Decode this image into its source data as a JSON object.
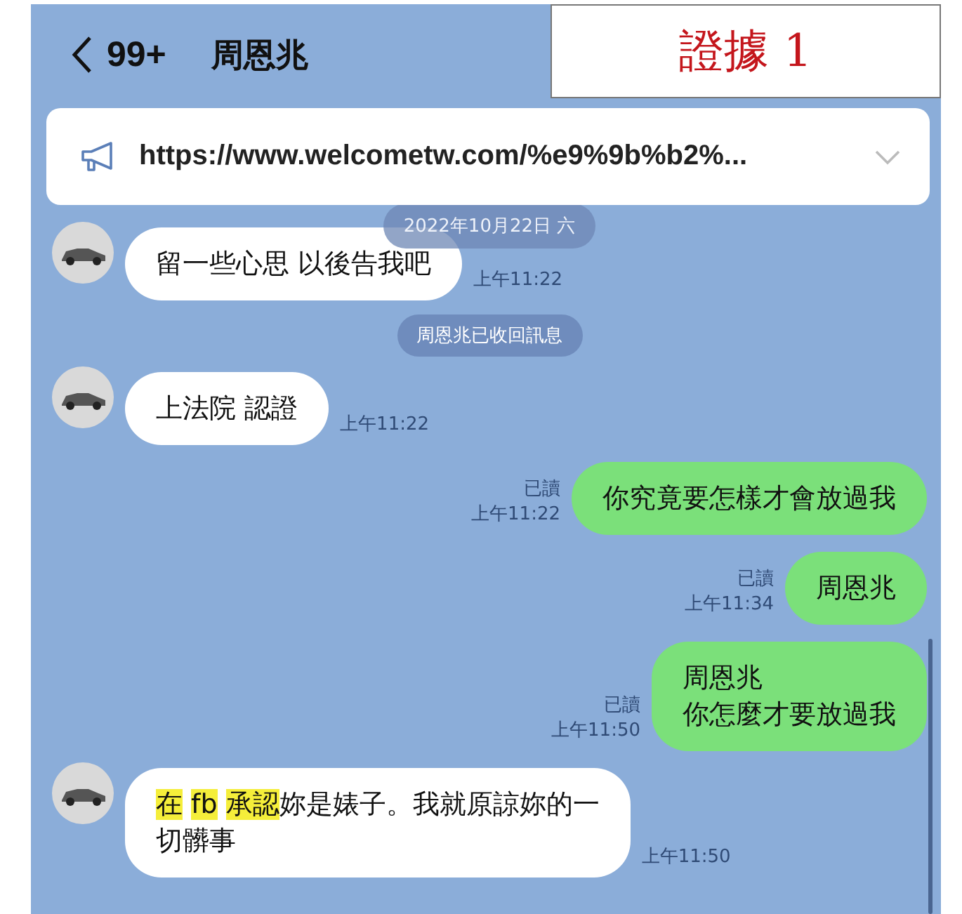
{
  "header": {
    "back_count": "99+",
    "contact": "周恩兆"
  },
  "evidence_label": "證據 1",
  "announcement": {
    "text": "https://www.welcometw.com/%e9%9b%b2%..."
  },
  "messages": [
    {
      "kind": "date",
      "text": "2022年10月22日 六"
    },
    {
      "kind": "incoming",
      "lines": [
        [
          {
            "text": "留一些心思 以後告我吧",
            "highlighted": false
          }
        ]
      ],
      "time": "上午11:22"
    },
    {
      "kind": "system",
      "text": "周恩兆已收回訊息"
    },
    {
      "kind": "incoming",
      "lines": [
        [
          {
            "text": "上法院 認證",
            "highlighted": false
          }
        ]
      ],
      "time": "上午11:22"
    },
    {
      "kind": "outgoing",
      "lines": [
        [
          {
            "text": "你究竟要怎樣才會放過我",
            "highlighted": false
          }
        ]
      ],
      "read_label": "已讀",
      "time": "上午11:22"
    },
    {
      "kind": "outgoing",
      "lines": [
        [
          {
            "text": "周恩兆",
            "highlighted": false
          }
        ]
      ],
      "read_label": "已讀",
      "time": "上午11:34"
    },
    {
      "kind": "outgoing",
      "lines": [
        [
          {
            "text": "周恩兆",
            "highlighted": false
          }
        ],
        [
          {
            "text": "你怎麼才要放過我",
            "highlighted": false
          }
        ]
      ],
      "read_label": "已讀",
      "time": "上午11:50"
    },
    {
      "kind": "incoming",
      "lines": [
        [
          {
            "text": "在 ",
            "highlighted": true
          },
          {
            "text": "fb ",
            "highlighted": true
          },
          {
            "text": "承認",
            "highlighted": true
          },
          {
            "text": "妳是婊子。我就原諒妳的一",
            "highlighted": false
          }
        ],
        [
          {
            "text": "切髒事",
            "highlighted": false
          }
        ]
      ],
      "time": "上午11:50"
    }
  ]
}
